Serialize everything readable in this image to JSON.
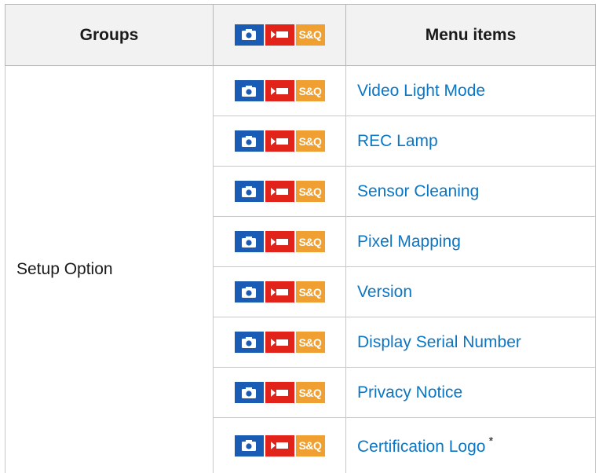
{
  "header": {
    "groups_label": "Groups",
    "menu_items_label": "Menu items",
    "mode_icons": [
      "camera-icon",
      "movie-icon",
      "s-and-q-icon"
    ]
  },
  "mode_badge_text": "S&Q",
  "colors": {
    "photo_mode": "#1a5cb3",
    "movie_mode": "#e2231a",
    "sq_mode": "#f0a030",
    "link": "#0a76c4"
  },
  "group": {
    "name": "Setup Option"
  },
  "rows": [
    {
      "label": "Video Light Mode"
    },
    {
      "label": "REC Lamp"
    },
    {
      "label": "Sensor Cleaning"
    },
    {
      "label": "Pixel Mapping"
    },
    {
      "label": "Version"
    },
    {
      "label": "Display Serial Number"
    },
    {
      "label": "Privacy Notice"
    },
    {
      "label": "Certification Logo",
      "footnote": "*"
    }
  ]
}
